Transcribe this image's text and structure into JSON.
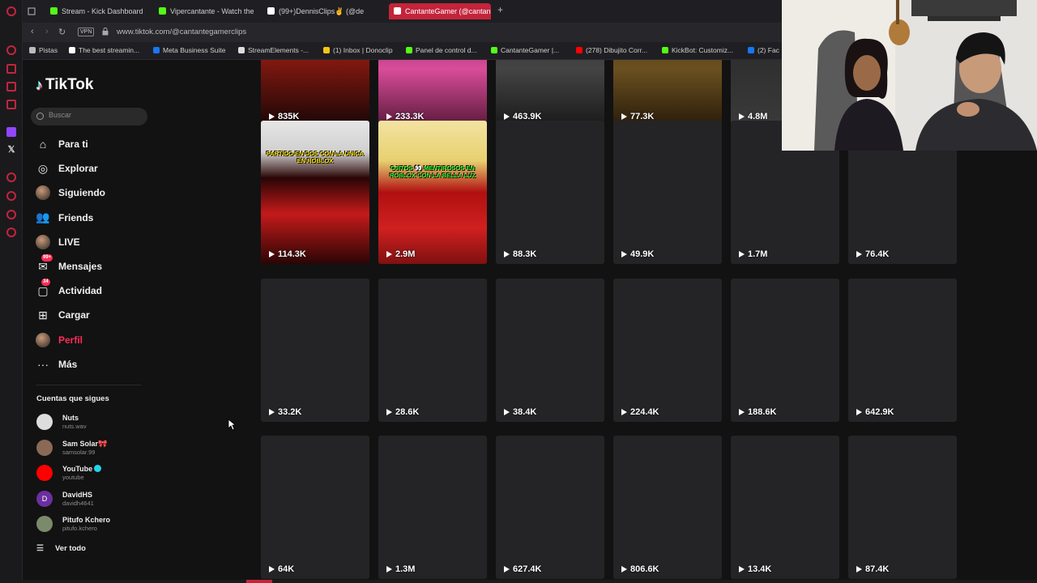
{
  "browser": {
    "tabs": [
      {
        "label": "Stream - Kick Dashboard",
        "color": "#53fc18"
      },
      {
        "label": "Vipercantante - Watch the",
        "color": "#53fc18"
      },
      {
        "label": "(99+)DennisClips✌ (@de",
        "color": "#ffffff"
      },
      {
        "label": "CantanteGamer (@cantan",
        "color": "#ffffff",
        "active": true
      }
    ],
    "new_tab": "+",
    "vpn": "VPN",
    "url": "www.tiktok.com/@cantantegamerclips",
    "bookmarks": [
      {
        "label": "Pistas",
        "color": "#bbbbbb"
      },
      {
        "label": "The best streamin...",
        "color": "#ffffff"
      },
      {
        "label": "Meta Business Suite",
        "color": "#1877f2"
      },
      {
        "label": "StreamElements -...",
        "color": "#dddddd"
      },
      {
        "label": "(1) Inbox | Donoclip",
        "color": "#f5c518"
      },
      {
        "label": "Panel de control d...",
        "color": "#53fc18"
      },
      {
        "label": "CantanteGamer |...",
        "color": "#53fc18"
      },
      {
        "label": "(278) Dibujito Corr...",
        "color": "#ff0000"
      },
      {
        "label": "KickBot: Customiz...",
        "color": "#53fc18"
      },
      {
        "label": "(2) Fac",
        "color": "#1877f2"
      }
    ]
  },
  "tiktok": {
    "logo": "TikTok",
    "search_placeholder": "Buscar",
    "menu": [
      {
        "label": "Para ti",
        "icon": "home-icon"
      },
      {
        "label": "Explorar",
        "icon": "compass-icon"
      },
      {
        "label": "Siguiendo",
        "icon": "following-avatar-icon"
      },
      {
        "label": "Friends",
        "icon": "friends-icon"
      },
      {
        "label": "LIVE",
        "icon": "live-icon"
      },
      {
        "label": "Mensajes",
        "icon": "messages-icon",
        "badge": "99+"
      },
      {
        "label": "Actividad",
        "icon": "activity-icon",
        "badge": "34"
      },
      {
        "label": "Cargar",
        "icon": "upload-icon"
      },
      {
        "label": "Perfil",
        "icon": "profile-avatar-icon",
        "active": true
      },
      {
        "label": "Más",
        "icon": "more-icon"
      }
    ],
    "following_title": "Cuentas que sigues",
    "following": [
      {
        "name": "Nuts",
        "user": "nuts.wav",
        "color": "#dddddd"
      },
      {
        "name": "Sam Solar🎀",
        "user": "samsolar.99",
        "color": "#8a6a55"
      },
      {
        "name": "YouTube",
        "user": "youtube",
        "color": "#ff0000",
        "verified": true
      },
      {
        "name": "DavidHS",
        "user": "davidh4641",
        "color": "#6b2fa0",
        "initial": "D"
      },
      {
        "name": "Pitufo Kchero",
        "user": "pitufo.kchero",
        "color": "#7a8a6a"
      }
    ],
    "see_all": "Ver todo",
    "videos": [
      {
        "views": "835K"
      },
      {
        "views": "233.3K"
      },
      {
        "views": "463.9K"
      },
      {
        "views": "77.3K"
      },
      {
        "views": "4.8M"
      },
      {
        "views": ""
      },
      {
        "views": "114.3K",
        "caption": "PARTIDO EN DOS CON LA UNICA EN ROBLOX"
      },
      {
        "views": "2.9M",
        "caption": "OJITOS 👀 MENTIROSOS EN ROBLOX CON LA BELLA LUZ"
      },
      {
        "views": "88.3K"
      },
      {
        "views": "49.9K"
      },
      {
        "views": "1.7M"
      },
      {
        "views": "76.4K"
      },
      {
        "views": "33.2K"
      },
      {
        "views": "28.6K"
      },
      {
        "views": "38.4K"
      },
      {
        "views": "224.4K"
      },
      {
        "views": "188.6K"
      },
      {
        "views": "642.9K"
      },
      {
        "views": "64K"
      },
      {
        "views": "1.3M"
      },
      {
        "views": "627.4K"
      },
      {
        "views": "806.6K"
      },
      {
        "views": "13.4K"
      },
      {
        "views": "87.4K"
      }
    ]
  },
  "colors": {
    "accent": "#fe2c55",
    "opera_red": "#c4243b",
    "kick_green": "#53fc18"
  }
}
